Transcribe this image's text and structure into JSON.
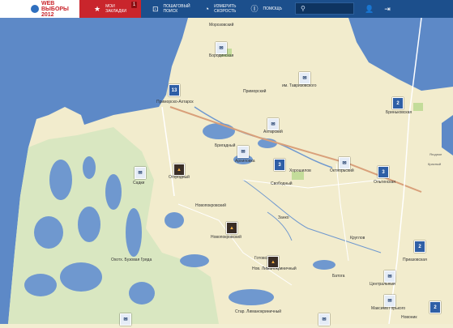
{
  "header": {
    "logo_line1": "WEB",
    "logo_line2": "ВЫБОРЫ",
    "logo_line3": "2012",
    "bookmarks_line1": "МОИ",
    "bookmarks_line2": "ЗАКЛАДКИ",
    "bookmarks_count": "1",
    "search_nav_line1": "ПОШАГОВЫЙ",
    "search_nav_line2": "ПОИСК",
    "speed_line1": "ИЗМЕРИТЬ",
    "speed_line2": "СКОРОСТЬ",
    "help_label": "ПОМОЩЬ",
    "search_placeholder": ""
  },
  "map": {
    "places": {
      "morozovsky": "Морозовский",
      "borodinskaya": "Бородинская",
      "primorsko": "Приморско-Ахтарск",
      "primorsky": "Приморский",
      "tavrizovsky": "им. Тавризовского",
      "bryukhovetskaya": "Бриньковская",
      "akhtarsky": "Ахтарский",
      "bugatsky": "Бригадный",
      "arkhipovka": "Архиповка",
      "khoroshilov": "Хорошилов",
      "oktyabrsky": "Октябрьский",
      "olginskaya": "Ольгинская",
      "svobodny": "Свободный",
      "sadki": "Садки",
      "ogorodny": "Огородный",
      "novopokrovsky": "Новопокровский",
      "zanko": "Занко",
      "novoukrainsky": "Новопокровский",
      "kruglov": "Круглов",
      "priazovskaya": "Приазовская",
      "gotovskiy": "Готовский",
      "limanokrinichny": "Нов. Лиманокриничный",
      "batoga": "Батога",
      "tsentralny": "Центральный",
      "maksima_gorkogo": "Максима Горького",
      "buzovaya": "Охотх. Бузовая Гряда",
      "yagodnoe": "Ягодное",
      "krasny": "Красный",
      "lnovaya": "Стар. Лиманокриничный",
      "novonyk": "Новоник"
    },
    "markers": {
      "m1": "13",
      "m2": "2",
      "m3": "3",
      "m4": "3",
      "m5": "2",
      "m6": "2"
    }
  }
}
